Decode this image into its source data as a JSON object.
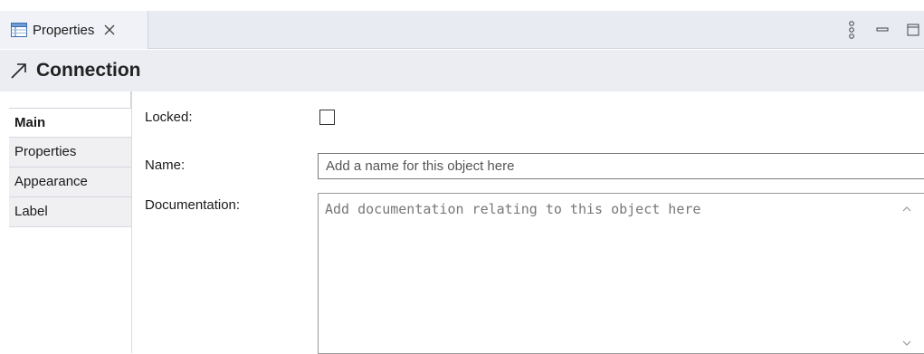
{
  "view": {
    "tab_label": "Properties",
    "tab_icon": "properties-table-icon",
    "close_icon": "close-icon",
    "controls": [
      "view-menu-icon",
      "minimize-icon",
      "maximize-icon"
    ]
  },
  "header": {
    "icon": "connection-arrow-icon",
    "title": "Connection"
  },
  "side_tabs": [
    {
      "label": "Main",
      "active": true
    },
    {
      "label": "Properties",
      "active": false
    },
    {
      "label": "Appearance",
      "active": false
    },
    {
      "label": "Label",
      "active": false
    }
  ],
  "form": {
    "locked_label": "Locked:",
    "locked_checked": false,
    "name_label": "Name:",
    "name_placeholder": "Add a name for this object here",
    "name_value": "",
    "documentation_label": "Documentation:",
    "documentation_placeholder": "Add documentation relating to this object here"
  },
  "colors": {
    "tabbar_bg": "#e8ebf2",
    "title_bg": "#ebedf3",
    "accent_blue": "#2b6cb0"
  }
}
